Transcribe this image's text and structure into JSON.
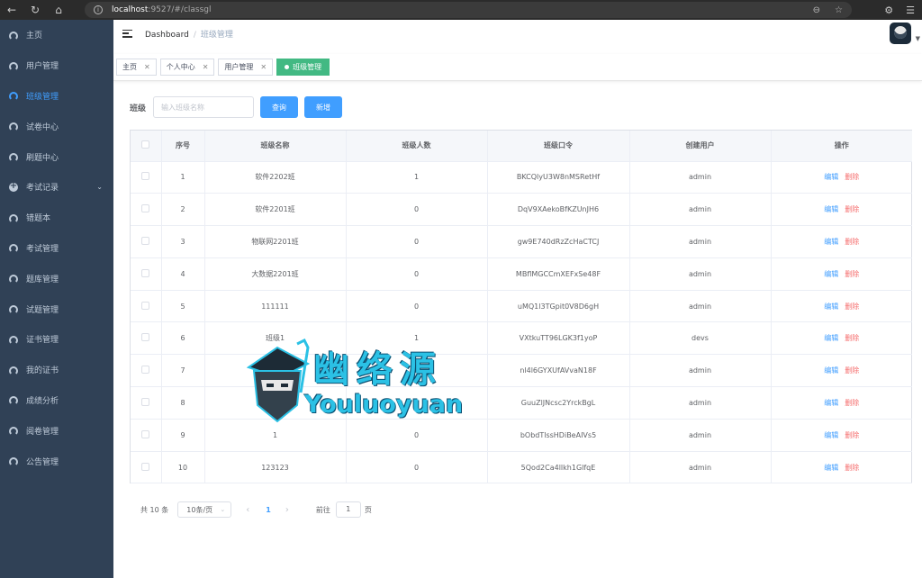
{
  "browser": {
    "url_host": "localhost",
    "url_path": ":9527/#/classgl"
  },
  "sidebar": {
    "items": [
      {
        "label": "主页",
        "icon": "dashboard-icon"
      },
      {
        "label": "用户管理",
        "icon": "dashboard-icon"
      },
      {
        "label": "班级管理",
        "icon": "dashboard-icon",
        "active": true
      },
      {
        "label": "试卷中心",
        "icon": "dashboard-icon"
      },
      {
        "label": "刷题中心",
        "icon": "dashboard-icon"
      },
      {
        "label": "考试记录",
        "icon": "plus-circle-icon",
        "expandable": true
      },
      {
        "label": "错题本",
        "icon": "dashboard-icon"
      },
      {
        "label": "考试管理",
        "icon": "dashboard-icon"
      },
      {
        "label": "题库管理",
        "icon": "dashboard-icon"
      },
      {
        "label": "试题管理",
        "icon": "dashboard-icon"
      },
      {
        "label": "证书管理",
        "icon": "dashboard-icon"
      },
      {
        "label": "我的证书",
        "icon": "dashboard-icon"
      },
      {
        "label": "成绩分析",
        "icon": "dashboard-icon"
      },
      {
        "label": "阅卷管理",
        "icon": "dashboard-icon"
      },
      {
        "label": "公告管理",
        "icon": "dashboard-icon"
      }
    ]
  },
  "navbar": {
    "breadcrumb": [
      "Dashboard",
      "班级管理"
    ],
    "separator": "/"
  },
  "tags": [
    {
      "label": "主页",
      "active": false
    },
    {
      "label": "个人中心",
      "active": false
    },
    {
      "label": "用户管理",
      "active": false
    },
    {
      "label": "班级管理",
      "active": true
    }
  ],
  "filter": {
    "label": "班级",
    "placeholder": "输入班级名称",
    "query_label": "查询",
    "add_label": "新增"
  },
  "table": {
    "headers": [
      "序号",
      "班级名称",
      "班级人数",
      "班级口令",
      "创建用户",
      "操作"
    ],
    "edit_label": "编辑",
    "delete_label": "删除",
    "rows": [
      {
        "no": "1",
        "name": "软件2202班",
        "count": "1",
        "code": "BKCQlyU3W8nMSRetHf",
        "creator": "admin"
      },
      {
        "no": "2",
        "name": "软件2201班",
        "count": "0",
        "code": "DqV9XAekoBfKZUnJH6",
        "creator": "admin"
      },
      {
        "no": "3",
        "name": "物联网2201班",
        "count": "0",
        "code": "gw9E740dRzZcHaCTCJ",
        "creator": "admin"
      },
      {
        "no": "4",
        "name": "大数据2201班",
        "count": "0",
        "code": "MBflMGCCmXEFxSe48F",
        "creator": "admin"
      },
      {
        "no": "5",
        "name": "111111",
        "count": "0",
        "code": "uMQ1l3TGpit0V8D6gH",
        "creator": "admin"
      },
      {
        "no": "6",
        "name": "班级1",
        "count": "1",
        "code": "VXtkuTT96LGK3f1yoP",
        "creator": "devs"
      },
      {
        "no": "7",
        "name": "",
        "count": "0",
        "code": "nl4l6GYXUfAVvaN18F",
        "creator": "admin"
      },
      {
        "no": "8",
        "name": "",
        "count": "0",
        "code": "GuuZlJNcsc2YrckBgL",
        "creator": "admin"
      },
      {
        "no": "9",
        "name": "1",
        "count": "0",
        "code": "bObdTlssHDiBeAIVs5",
        "creator": "admin"
      },
      {
        "no": "10",
        "name": "123123",
        "count": "0",
        "code": "5Qod2Ca4llkh1GlfqE",
        "creator": "admin"
      }
    ]
  },
  "pagination": {
    "total_text": "共 10 条",
    "page_size": "10条/页",
    "current_page": "1",
    "goto_label": "前往",
    "goto_value": "1",
    "page_suffix": "页"
  },
  "watermark": {
    "title": "幽络源",
    "subtitle": "Youluoyuan"
  },
  "colors": {
    "sidebar_bg": "#304156",
    "primary": "#409eff",
    "danger": "#f56c6c",
    "active_tag": "#42b983"
  }
}
